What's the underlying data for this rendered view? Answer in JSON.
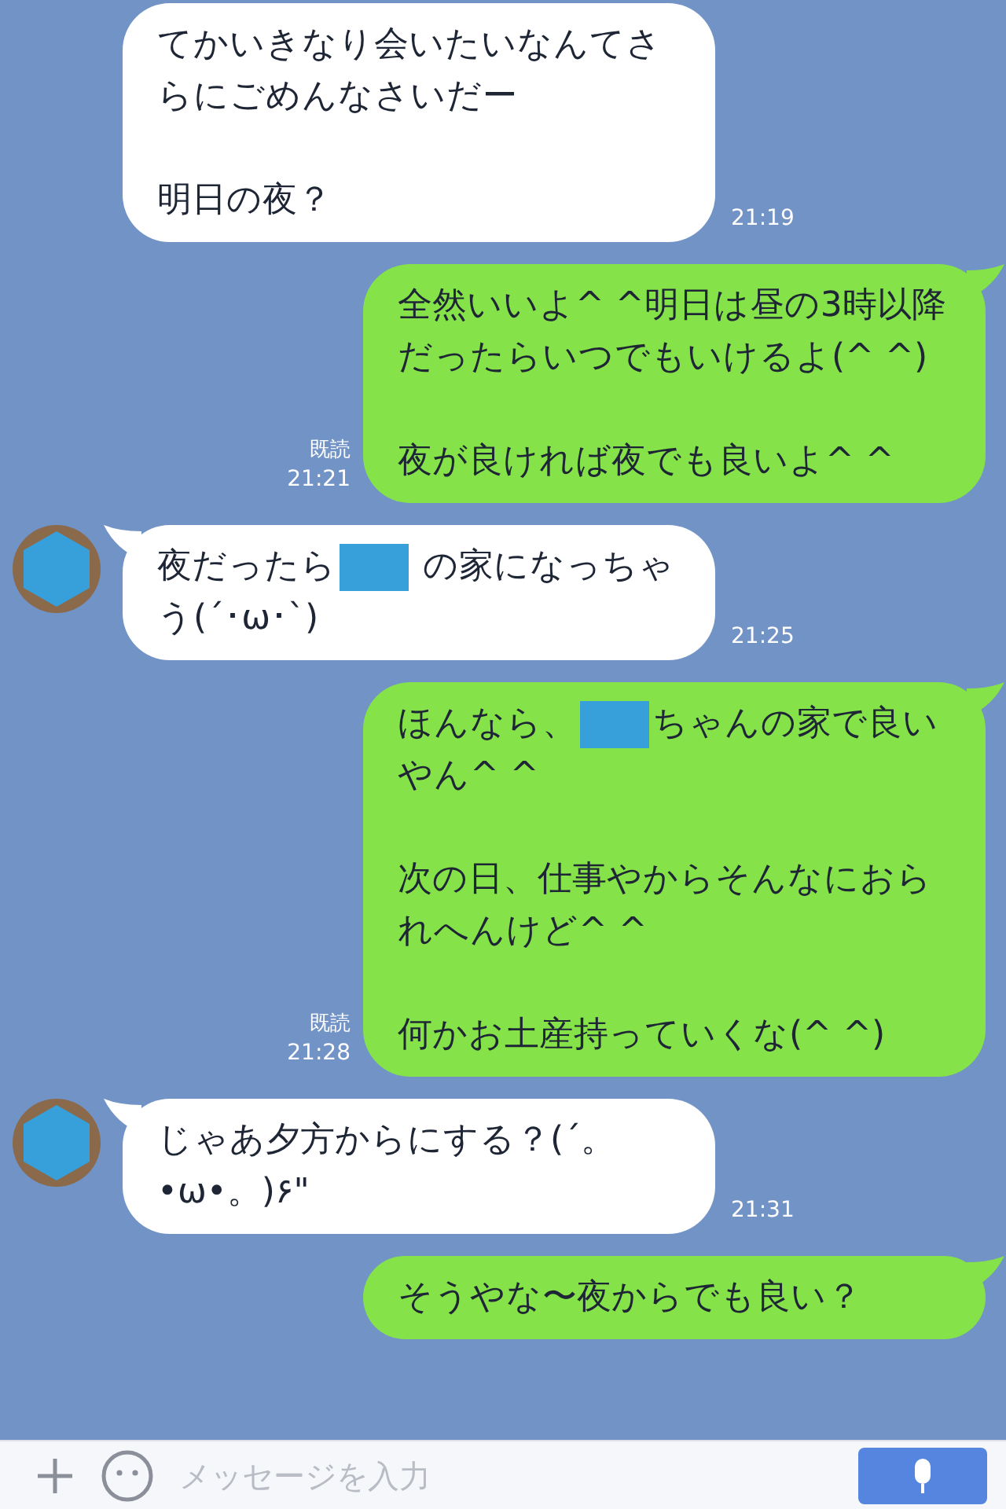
{
  "messages": [
    {
      "kind": "incoming",
      "show_avatar": false,
      "paragraphs": [
        [
          {
            "kind": "text",
            "text": "てかいきなり会いたいなんてさらにごめんなさいだー"
          }
        ],
        [
          {
            "kind": "text",
            "text": "明日の夜？"
          }
        ]
      ],
      "time": "21:19"
    },
    {
      "kind": "outgoing",
      "paragraphs": [
        [
          {
            "kind": "text",
            "text": "全然いいよ^ ^明日は昼の3時以降だったらいつでもいけるよ(^ ^)"
          }
        ],
        [
          {
            "kind": "text",
            "text": "夜が良ければ夜でも良いよ^ ^"
          }
        ]
      ],
      "read_label": "既読",
      "time": "21:21"
    },
    {
      "kind": "incoming",
      "show_avatar": true,
      "paragraphs": [
        [
          {
            "kind": "text",
            "text": "夜だったら"
          },
          {
            "kind": "redacted"
          },
          {
            "kind": "text",
            "text": " の家になっちゃう(´･ω･`)"
          }
        ]
      ],
      "time": "21:25"
    },
    {
      "kind": "outgoing",
      "paragraphs": [
        [
          {
            "kind": "text",
            "text": "ほんなら、"
          },
          {
            "kind": "redacted"
          },
          {
            "kind": "text",
            "text": "ちゃんの家で良いやん^ ^"
          }
        ],
        [
          {
            "kind": "text",
            "text": "次の日、仕事やからそんなにおられへんけど^ ^"
          }
        ],
        [
          {
            "kind": "text",
            "text": "何かお土産持っていくな(^ ^)"
          }
        ]
      ],
      "read_label": "既読",
      "time": "21:28"
    },
    {
      "kind": "incoming",
      "show_avatar": true,
      "paragraphs": [
        [
          {
            "kind": "text",
            "text": "じゃあ夕方からにする？(´。•ω•。)۶\""
          }
        ]
      ],
      "time": "21:31"
    },
    {
      "kind": "outgoing",
      "paragraphs": [
        [
          {
            "kind": "text",
            "text": "そうやな〜夜からでも良い？"
          }
        ]
      ]
    }
  ],
  "input": {
    "placeholder": "メッセージを入力"
  }
}
